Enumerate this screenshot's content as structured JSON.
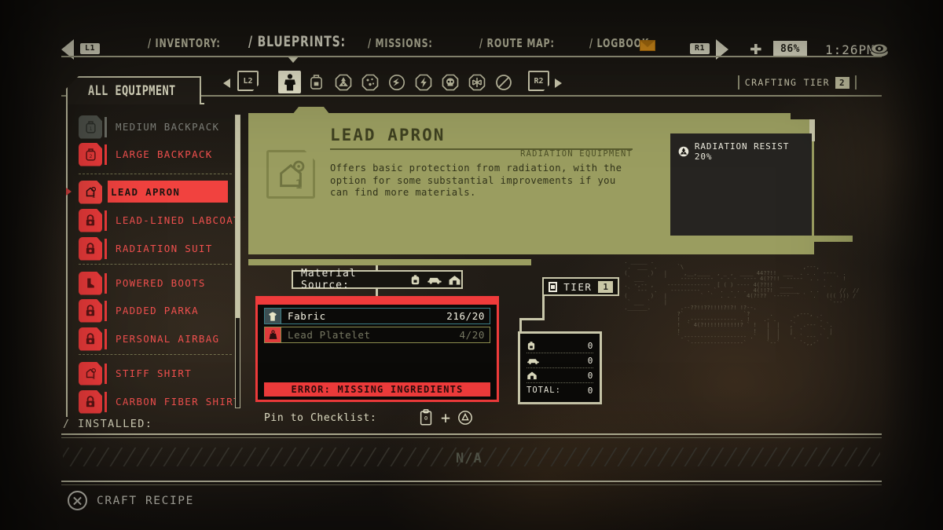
{
  "topbar": {
    "left_bumper": "L1",
    "right_bumper": "R1",
    "tabs": [
      {
        "label": "/ INVENTORY:",
        "active": false
      },
      {
        "label": "/ BLUEPRINTS:",
        "active": true
      },
      {
        "label": "/ MISSIONS:",
        "active": false
      },
      {
        "label": "/ ROUTE MAP:",
        "active": false
      },
      {
        "label": "/ LOGBOOK:",
        "active": false
      }
    ],
    "battery": "86%",
    "time": "1:26PM",
    "mail_icon": "envelope-icon",
    "globe_icon": "eye-globe-icon"
  },
  "subtabs": {
    "left_bumper": "L2",
    "right_bumper": "R2",
    "categories": [
      {
        "name": "body-suit-icon",
        "selected": true
      },
      {
        "name": "backpack-icon",
        "selected": false
      },
      {
        "name": "radiation-icon",
        "selected": false
      },
      {
        "name": "biohazard-icon",
        "selected": false
      },
      {
        "name": "impact-icon",
        "selected": false
      },
      {
        "name": "electric-icon",
        "selected": false
      },
      {
        "name": "toxic-skull-icon",
        "selected": false
      },
      {
        "name": "cold-snowflake-icon",
        "selected": false
      },
      {
        "name": "none-blocked-icon",
        "selected": false
      }
    ],
    "crafting_tier_label": "CRAFTING TIER",
    "crafting_tier_value": "2"
  },
  "sidebar": {
    "header": "ALL EQUIPMENT",
    "items": [
      {
        "label": "MEDIUM BACKPACK",
        "state": "owned",
        "icon": "backpack-1-icon",
        "divider_after": false
      },
      {
        "label": "LARGE BACKPACK",
        "state": "locked",
        "icon": "backpack-2-icon",
        "divider_after": true
      },
      {
        "label": "LEAD APRON",
        "state": "selected",
        "icon": "apron-1-icon",
        "divider_after": false
      },
      {
        "label": "LEAD-LINED LABCOAT",
        "state": "locked",
        "icon": "lock-icon",
        "divider_after": false
      },
      {
        "label": "RADIATION SUIT",
        "state": "locked",
        "icon": "lock-icon",
        "divider_after": true
      },
      {
        "label": "POWERED BOOTS",
        "state": "locked",
        "icon": "boot-icon",
        "divider_after": false
      },
      {
        "label": "PADDED PARKA",
        "state": "locked",
        "icon": "lock-icon",
        "divider_after": false
      },
      {
        "label": "PERSONAL AIRBAG",
        "state": "locked",
        "icon": "lock-icon",
        "divider_after": true
      },
      {
        "label": "STIFF SHIRT",
        "state": "locked",
        "icon": "shirt-1-icon",
        "divider_after": false
      },
      {
        "label": "CARBON FIBER SHIRT",
        "state": "locked",
        "icon": "lock-icon",
        "divider_after": false
      }
    ]
  },
  "detail": {
    "title": "LEAD APRON",
    "category": "RADIATION EQUIPMENT",
    "description": "Offers basic protection from radiation, with the option for some substantial improvements if you can find more materials.",
    "icon": "apron-blueprint-icon",
    "stats": [
      {
        "icon": "radiation-icon",
        "label": "RADIATION RESIST 20%"
      }
    ]
  },
  "material_source": {
    "label": "Material Source:",
    "icons": [
      "backpack-icon",
      "car-icon",
      "home-icon"
    ]
  },
  "recipe": {
    "ingredients": [
      {
        "name": "Fabric",
        "have": "216",
        "need": "20",
        "count": "216/20",
        "fulfilled": true,
        "icon": "shirt-icon"
      },
      {
        "name": "Lead Platelet",
        "have": "4",
        "need": "20",
        "count": "4/20",
        "fulfilled": false,
        "icon": "weight-icon"
      }
    ],
    "error": "ERROR: MISSING INGREDIENTS"
  },
  "tier": {
    "label": "TIER",
    "value": "1",
    "icon": "square-dot-icon"
  },
  "totals": {
    "rows": [
      {
        "icon": "backpack-icon",
        "value": "0"
      },
      {
        "icon": "car-icon",
        "value": "0"
      },
      {
        "icon": "home-icon",
        "value": "0"
      }
    ],
    "total_label": "TOTAL:",
    "total_value": "0"
  },
  "installed": {
    "label": "/ INSTALLED:",
    "empty_value": "N/A"
  },
  "pin": {
    "label": "Pin to Checklist:",
    "icons": [
      "clipboard-icon",
      "plus-icon",
      "triangle-button-icon"
    ]
  },
  "footer": {
    "craft_button_glyph": "X",
    "craft_label": "CRAFT RECIPE"
  },
  "colors": {
    "olive_panel": "#9a9d60",
    "accent_red": "#ef3b3b",
    "cream": "#eceadd",
    "background": "#1b1813",
    "teal_border": "#3c7e86"
  }
}
